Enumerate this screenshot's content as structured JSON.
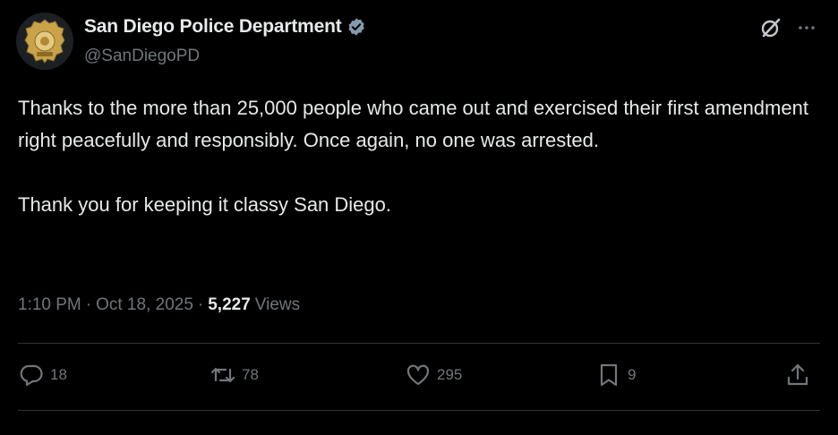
{
  "author": {
    "display_name": "San Diego Police Department",
    "handle": "@SanDiegoPD",
    "verified": true
  },
  "tweet": {
    "text": "Thanks to the more than 25,000 people who came out and exercised their first amendment right peacefully and responsibly. Once again, no one was arrested.\n\nThank you for keeping it classy San Diego.",
    "time": "1:10 PM",
    "date": "Oct 18, 2025",
    "views_count": "5,227",
    "views_label": "Views"
  },
  "engagement": {
    "replies": "18",
    "reposts": "78",
    "likes": "295",
    "bookmarks": "9"
  },
  "icons": {
    "verified": "verified-badge-icon",
    "grok": "grok-icon",
    "more": "more-icon",
    "reply": "reply-icon",
    "repost": "repost-icon",
    "like": "like-icon",
    "bookmark": "bookmark-icon",
    "share": "share-icon"
  },
  "colors": {
    "background": "#000000",
    "text": "#e7e9ea",
    "muted": "#71767b",
    "divider": "#2f3336",
    "badge_gold": "#c9a24a"
  }
}
